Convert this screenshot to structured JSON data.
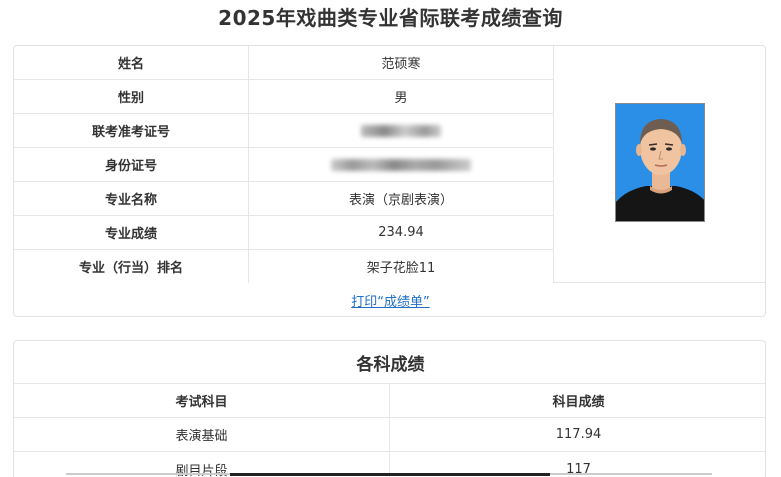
{
  "page": {
    "title": "2025年戏曲类专业省际联考成绩查询"
  },
  "info": {
    "rows": [
      {
        "label": "姓名",
        "value": "范硕寒"
      },
      {
        "label": "性别",
        "value": "男"
      },
      {
        "label": "联考准考证号",
        "value": ""
      },
      {
        "label": "身份证号",
        "value": ""
      },
      {
        "label": "专业名称",
        "value": "表演（京剧表演）"
      },
      {
        "label": "专业成绩",
        "value": "234.94"
      },
      {
        "label": "专业（行当）排名",
        "value": "架子花脸11"
      }
    ],
    "print_link": "打印“成绩单”"
  },
  "scores": {
    "title": "各科成绩",
    "headers": [
      "考试科目",
      "科目成绩"
    ],
    "rows": [
      {
        "subject": "表演基础",
        "score": "117.94"
      },
      {
        "subject": "剧目片段",
        "score": "117"
      }
    ]
  },
  "colors": {
    "link": "#1e6fc7",
    "photo_background": "#2b8fe8",
    "border": "#e6e6e6"
  }
}
